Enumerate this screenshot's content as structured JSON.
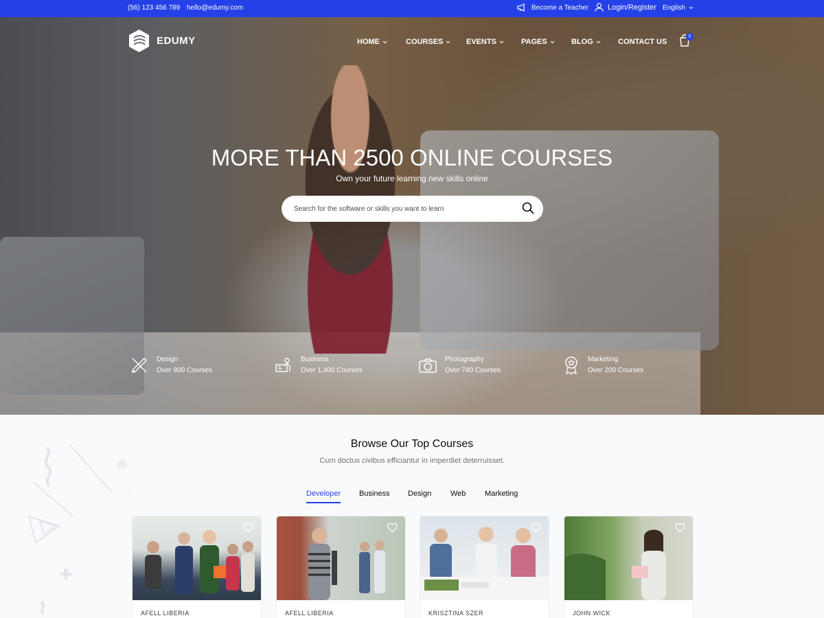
{
  "topbar": {
    "phone": "(56) 123 456 789",
    "email": "hello@edumy.com",
    "become_teacher": "Become a Teacher",
    "login": "Login/Register",
    "language": "English"
  },
  "brand": {
    "name": "EDUMY"
  },
  "nav": {
    "items": [
      "HOME",
      "COURSES",
      "EVENTS",
      "PAGES",
      "BLOG",
      "CONTACT US"
    ],
    "cart_count": "0"
  },
  "hero": {
    "title": "MORE THAN 2500 ONLINE COURSES",
    "subtitle": "Own your future learning new skills online",
    "search_placeholder": "Search for the software or skills you want to learn"
  },
  "categories": [
    {
      "name": "Design",
      "count": "Over 800 Courses",
      "icon": "pencil-ruler-icon"
    },
    {
      "name": "Business",
      "count": "Over 1,400 Courses",
      "icon": "presentation-icon"
    },
    {
      "name": "Photography",
      "count": "Over 740 Courses",
      "icon": "camera-icon"
    },
    {
      "name": "Marketing",
      "count": "Over 200 Courses",
      "icon": "award-icon"
    }
  ],
  "courses_section": {
    "title": "Browse Our Top Courses",
    "subtitle": "Cum doctus civibus efficiantur in imperdiet deterruisset.",
    "tabs": [
      "Developer",
      "Business",
      "Design",
      "Web",
      "Marketing"
    ],
    "active_tab": "Developer"
  },
  "course_cards": [
    {
      "author": "AFELL LIBERIA"
    },
    {
      "author": "AFELL LIBERIA"
    },
    {
      "author": "KRISZTINA SZER"
    },
    {
      "author": "JOHN WICK"
    }
  ],
  "colors": {
    "accent": "#2441e7",
    "heading": "#0a0a0a",
    "muted": "#6f7074"
  }
}
